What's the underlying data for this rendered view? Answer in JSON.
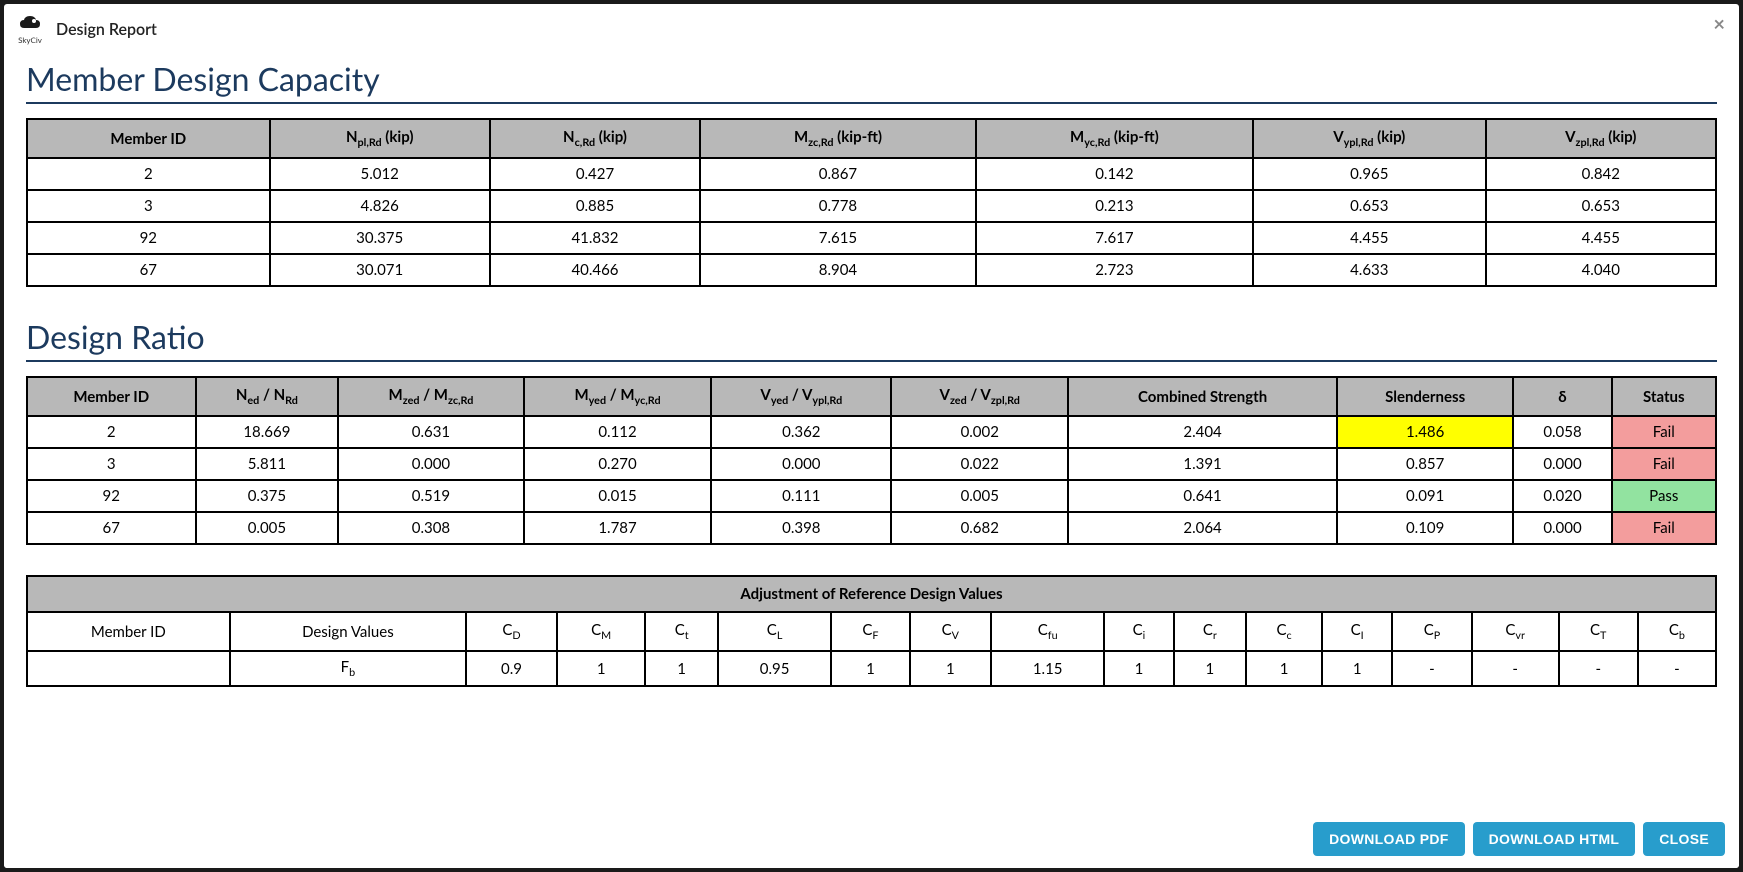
{
  "header": {
    "logo_text": "SkyCiv",
    "title": "Design Report",
    "close": "×"
  },
  "section_capacity": {
    "title": "Member Design Capacity",
    "headers": {
      "member_id": "Member ID",
      "npl_rd": "N<sub>pl,Rd</sub> (kip)",
      "nc_rd": "N<sub>c,Rd</sub> (kip)",
      "mzc_rd": "M<sub>zc,Rd</sub> (kip-ft)",
      "myc_rd": "M<sub>yc,Rd</sub> (kip-ft)",
      "vypl_rd": "V<sub>ypl,Rd</sub> (kip)",
      "vzpl_rd": "V<sub>zpl,Rd</sub> (kip)"
    },
    "rows": [
      {
        "id": "2",
        "npl": "5.012",
        "nc": "0.427",
        "mzc": "0.867",
        "myc": "0.142",
        "vypl": "0.965",
        "vzpl": "0.842"
      },
      {
        "id": "3",
        "npl": "4.826",
        "nc": "0.885",
        "mzc": "0.778",
        "myc": "0.213",
        "vypl": "0.653",
        "vzpl": "0.653"
      },
      {
        "id": "92",
        "npl": "30.375",
        "nc": "41.832",
        "mzc": "7.615",
        "myc": "7.617",
        "vypl": "4.455",
        "vzpl": "4.455"
      },
      {
        "id": "67",
        "npl": "30.071",
        "nc": "40.466",
        "mzc": "8.904",
        "myc": "2.723",
        "vypl": "4.633",
        "vzpl": "4.040"
      }
    ]
  },
  "section_ratio": {
    "title": "Design Ratio",
    "headers": {
      "member_id": "Member ID",
      "ned_nrd": "N<sub>ed</sub> / N<sub>Rd</sub>",
      "mzed_mzcrd": "M<sub>zed</sub> / M<sub>zc,Rd</sub>",
      "myed_mycrd": "M<sub>yed</sub> / M<sub>yc,Rd</sub>",
      "vyed_vyplrd": "V<sub>yed</sub> / V<sub>ypl,Rd</sub>",
      "vzed_vzplrd": "V<sub>zed</sub> / V<sub>zpl,Rd</sub>",
      "combined": "Combined Strength",
      "slenderness": "Slenderness",
      "delta": "δ",
      "status": "Status"
    },
    "rows": [
      {
        "id": "2",
        "ned": "18.669",
        "mzed": "0.631",
        "myed": "0.112",
        "vyed": "0.362",
        "vzed": "0.002",
        "comb": "2.404",
        "slender": "1.486",
        "slender_hl": true,
        "delta": "0.058",
        "status": "Fail"
      },
      {
        "id": "3",
        "ned": "5.811",
        "mzed": "0.000",
        "myed": "0.270",
        "vyed": "0.000",
        "vzed": "0.022",
        "comb": "1.391",
        "slender": "0.857",
        "slender_hl": false,
        "delta": "0.000",
        "status": "Fail"
      },
      {
        "id": "92",
        "ned": "0.375",
        "mzed": "0.519",
        "myed": "0.015",
        "vyed": "0.111",
        "vzed": "0.005",
        "comb": "0.641",
        "slender": "0.091",
        "slender_hl": false,
        "delta": "0.020",
        "status": "Pass"
      },
      {
        "id": "67",
        "ned": "0.005",
        "mzed": "0.308",
        "myed": "1.787",
        "vyed": "0.398",
        "vzed": "0.682",
        "comb": "2.064",
        "slender": "0.109",
        "slender_hl": false,
        "delta": "0.000",
        "status": "Fail"
      }
    ]
  },
  "section_adjustment": {
    "title_row": "Adjustment of Reference Design Values",
    "headers": {
      "member_id": "Member ID",
      "design_values": "Design Values",
      "cd": "C<sub>D</sub>",
      "cm": "C<sub>M</sub>",
      "ct": "C<sub>t</sub>",
      "cl": "C<sub>L</sub>",
      "cf": "C<sub>F</sub>",
      "cv": "C<sub>V</sub>",
      "cfu": "C<sub>fu</sub>",
      "ci": "C<sub>i</sub>",
      "cr": "C<sub>r</sub>",
      "cc": "C<sub>c</sub>",
      "cI": "C<sub>I</sub>",
      "cp": "C<sub>P</sub>",
      "cvr": "C<sub>vr</sub>",
      "cT": "C<sub>T</sub>",
      "cb": "C<sub>b</sub>"
    },
    "rows": [
      {
        "member_id": "",
        "dv": "F<sub>b</sub>",
        "cd": "0.9",
        "cm": "1",
        "ct": "1",
        "cl": "0.95",
        "cf": "1",
        "cv": "1",
        "cfu": "1.15",
        "ci": "1",
        "cr": "1",
        "cc": "1",
        "cI": "1",
        "cp": "-",
        "cvr": "-",
        "cT": "-",
        "cb": "-"
      }
    ]
  },
  "footer": {
    "download_pdf": "DOWNLOAD PDF",
    "download_html": "DOWNLOAD HTML",
    "close": "CLOSE"
  }
}
